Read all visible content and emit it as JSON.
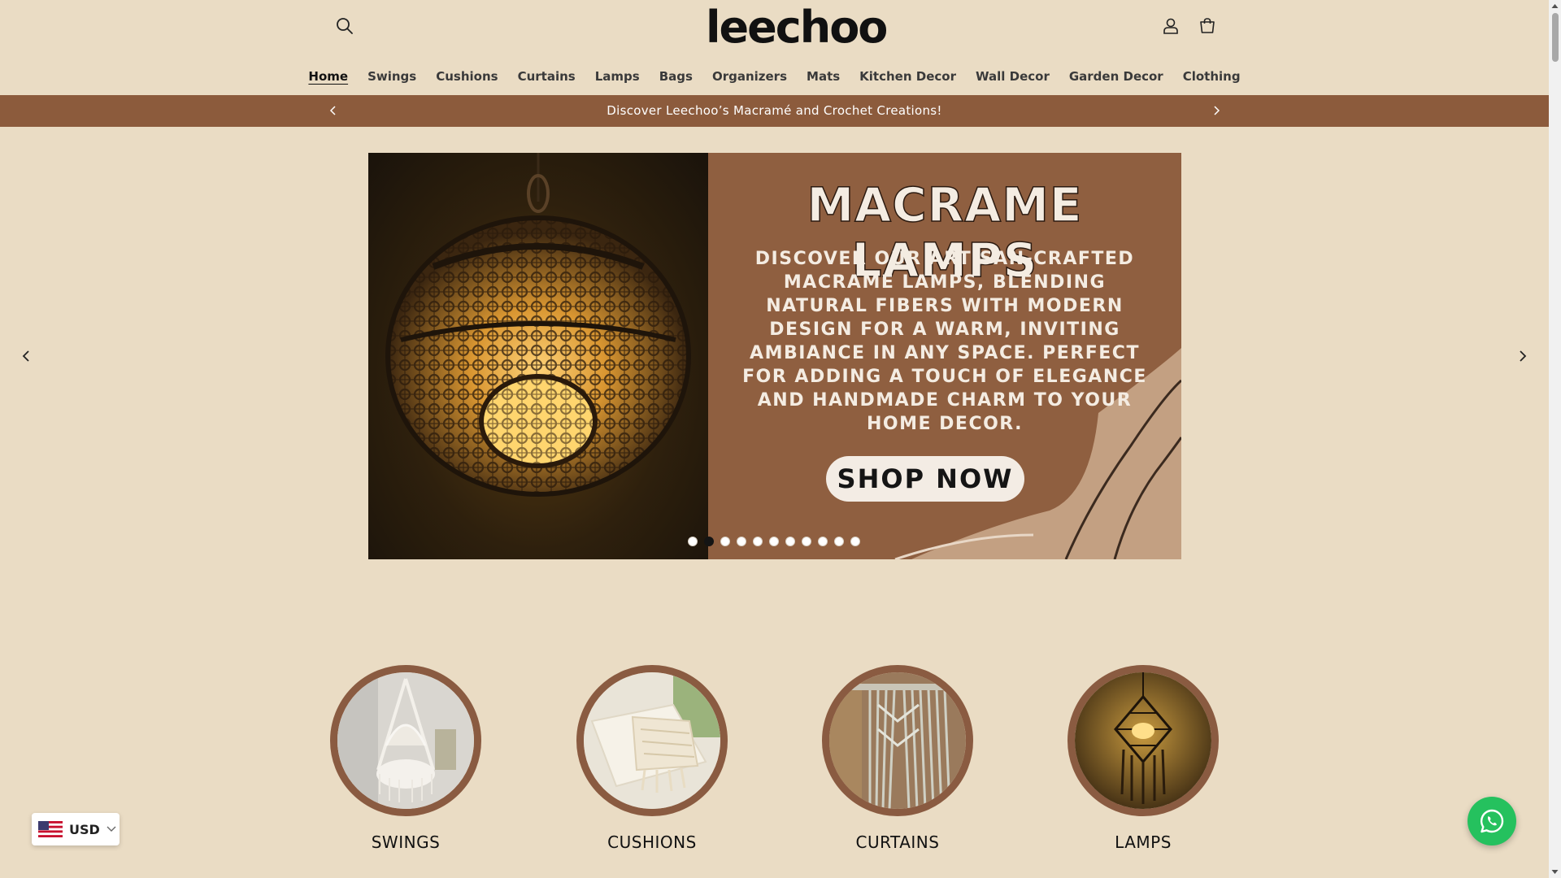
{
  "header": {
    "logo_text": "leechoo",
    "search_icon": "search-icon",
    "account_icon": "user-icon",
    "cart_icon": "cart-icon"
  },
  "nav": {
    "items": [
      {
        "label": "Home",
        "active": true
      },
      {
        "label": "Swings"
      },
      {
        "label": "Cushions"
      },
      {
        "label": "Curtains"
      },
      {
        "label": "Lamps"
      },
      {
        "label": "Bags"
      },
      {
        "label": "Organizers"
      },
      {
        "label": "Mats"
      },
      {
        "label": "Kitchen Decor"
      },
      {
        "label": "Wall Decor"
      },
      {
        "label": "Garden Decor"
      },
      {
        "label": "Clothing"
      }
    ]
  },
  "announcement": {
    "text": "Discover Leechoo’s Macramé and Crochet Creations!"
  },
  "banner": {
    "title": "MACRAME LAMPS",
    "body": "DISCOVER OUR ARTISAN-CRAFTED MACRAME LAMPS, BLENDING NATURAL FIBERS WITH MODERN DESIGN FOR A WARM, INVITING AMBIANCE IN ANY SPACE. PERFECT FOR ADDING A TOUCH OF ELEGANCE AND HANDMADE CHARM TO YOUR HOME DECOR.",
    "cta": "SHOP NOW",
    "slide_count": 11,
    "active_slide": 2
  },
  "categories": [
    {
      "label": "SWINGS"
    },
    {
      "label": "CUSHIONS"
    },
    {
      "label": "CURTAINS"
    },
    {
      "label": "LAMPS"
    }
  ],
  "currency": {
    "code": "USD",
    "flag_icon": "us-flag-icon"
  },
  "colors": {
    "background": "#eadcc4",
    "announcement_bar": "#8c5b3c",
    "banner_panel": "#8f5f40",
    "category_ring": "#8a5b41",
    "whatsapp": "#25c15e"
  }
}
